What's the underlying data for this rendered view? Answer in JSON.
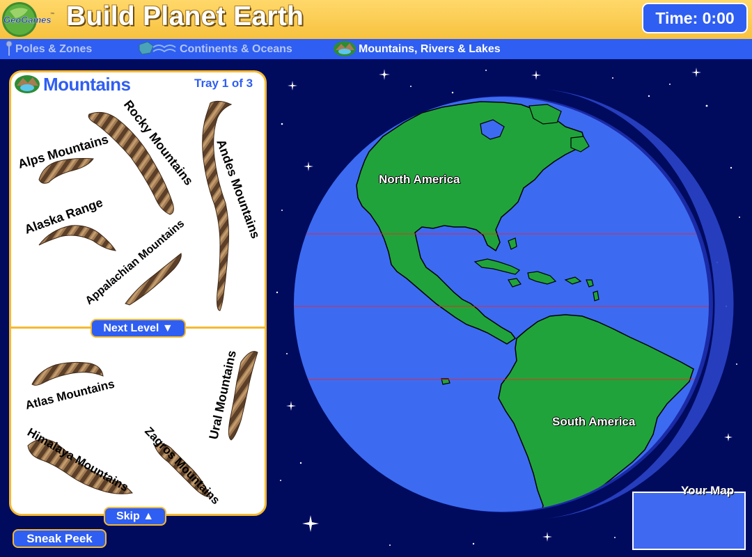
{
  "header": {
    "logo_text": "GeoGames",
    "logo_tm": "™",
    "title": "Build Planet Earth",
    "timer": "Time: 0:00"
  },
  "nav": {
    "items": [
      {
        "label": "Poles & Zones",
        "active": false
      },
      {
        "label": "Continents & Oceans",
        "active": false
      },
      {
        "label": "Mountains, Rivers & Lakes",
        "active": true
      }
    ]
  },
  "tray": {
    "title": "Mountains",
    "counter": "Tray 1 of 3",
    "next_level": "Next Level",
    "skip": "Skip",
    "sneak_peek": "Sneak Peek",
    "pieces": [
      {
        "label": "Alps Mountains"
      },
      {
        "label": "Rocky Mountains"
      },
      {
        "label": "Andes Mountains"
      },
      {
        "label": "Alaska Range"
      },
      {
        "label": "Appalachian Mountains"
      },
      {
        "label": "Atlas Mountains"
      },
      {
        "label": "Ural Mountains"
      },
      {
        "label": "Himalaya Mountains"
      },
      {
        "label": "Zagros Mountains"
      }
    ]
  },
  "globe": {
    "labels": [
      "North America",
      "South America"
    ]
  },
  "mini_map": {
    "label": "Your Map"
  },
  "colors": {
    "header_bg": "#f7c23e",
    "nav_bg": "#2f5ef2",
    "space": "#000b5e",
    "ocean": "#3c6bf2",
    "land": "#21a33c",
    "mountain_brown": "#8a6444",
    "tray_border": "#f5b930"
  }
}
